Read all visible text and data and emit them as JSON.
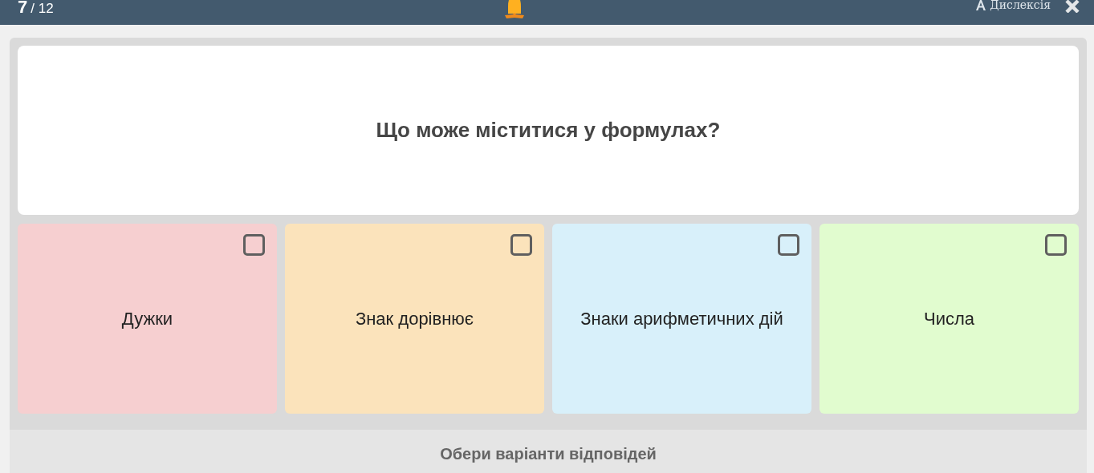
{
  "header": {
    "current": "7",
    "total": "/ 12",
    "dyslexia_label": "Дислексія"
  },
  "question": "Що може міститися у формулах?",
  "options": [
    {
      "label": "Дужки",
      "color": "#f6cfd0",
      "checked": false
    },
    {
      "label": "Знак дорівнює",
      "color": "#fbe3bb",
      "checked": false
    },
    {
      "label": "Знаки арифметичних дій",
      "color": "#d8f0fa",
      "checked": false
    },
    {
      "label": "Числа",
      "color": "#e1fccf",
      "checked": false
    }
  ],
  "footer": "Обери варіанти відповідей"
}
